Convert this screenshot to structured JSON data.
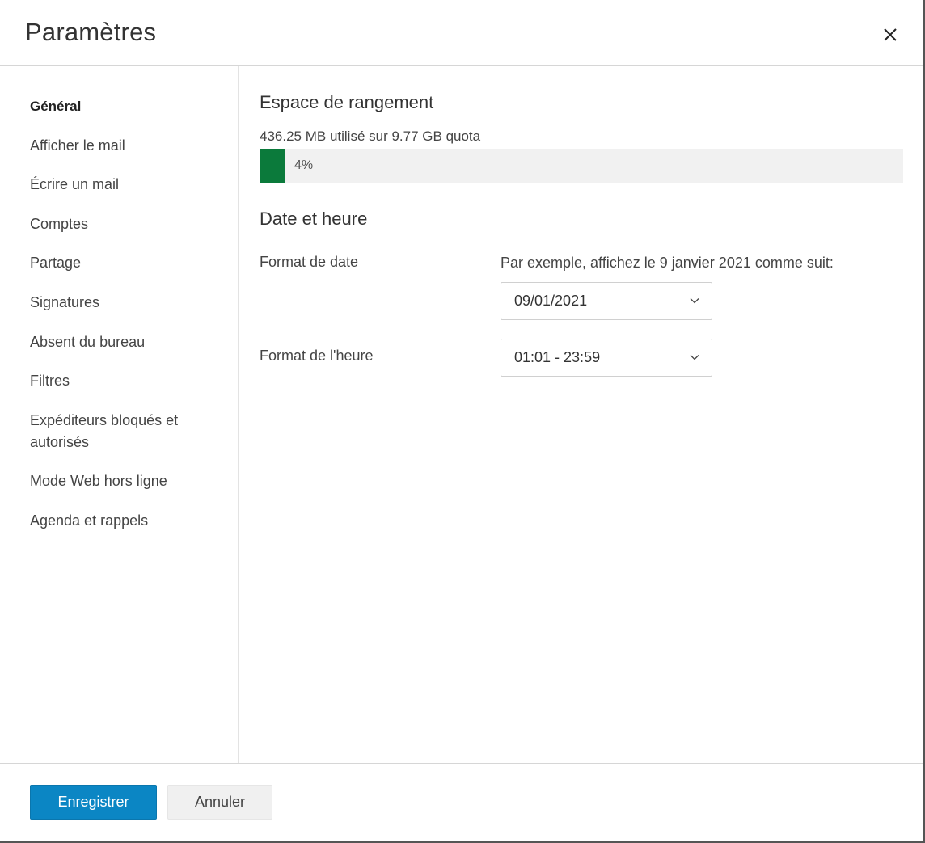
{
  "dialog": {
    "title": "Paramètres",
    "close_icon": "close-icon"
  },
  "sidebar": {
    "items": [
      {
        "label": "Général",
        "active": true
      },
      {
        "label": "Afficher le mail"
      },
      {
        "label": "Écrire un mail"
      },
      {
        "label": "Comptes"
      },
      {
        "label": "Partage"
      },
      {
        "label": "Signatures"
      },
      {
        "label": "Absent du bureau"
      },
      {
        "label": "Filtres"
      },
      {
        "label": "Expéditeurs bloqués et autorisés"
      },
      {
        "label": "Mode Web hors ligne"
      },
      {
        "label": "Agenda et rappels"
      }
    ]
  },
  "storage": {
    "title": "Espace de rangement",
    "usage_text": "436.25 MB utilisé sur 9.77 GB quota",
    "percent_label": "4%",
    "percent_value": 0.04,
    "fill_color": "#0b7a3b"
  },
  "datetime": {
    "title": "Date et heure",
    "date_format_label": "Format de date",
    "date_hint": "Par exemple, affichez le 9 janvier 2021 comme suit:",
    "date_format_value": "09/01/2021",
    "time_format_label": "Format de l'heure",
    "time_format_value": "01:01 - 23:59"
  },
  "footer": {
    "save_label": "Enregistrer",
    "cancel_label": "Annuler"
  },
  "colors": {
    "primary": "#0b86c4",
    "progress_green": "#0b7a3b"
  }
}
